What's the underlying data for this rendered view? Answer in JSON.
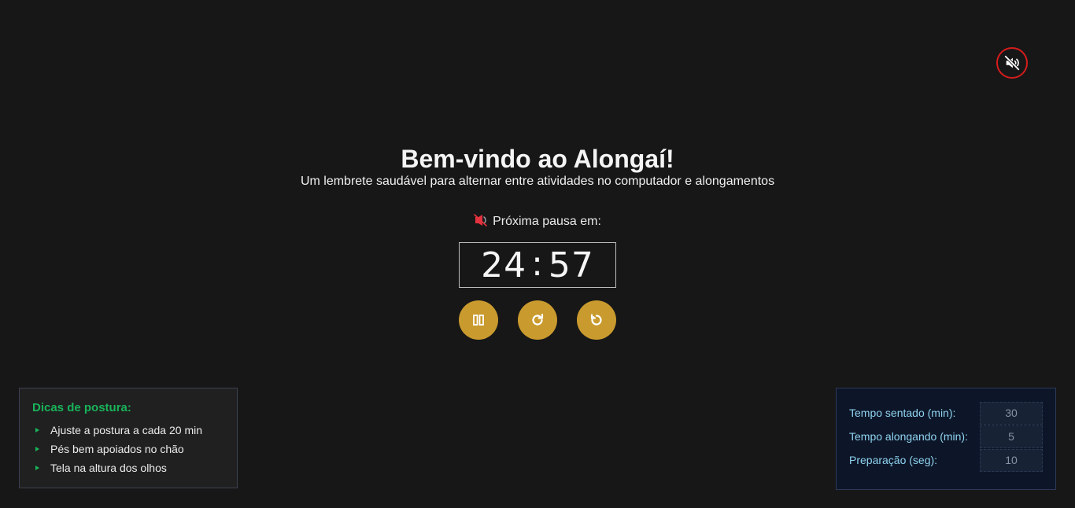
{
  "sound": {
    "icon": "speaker-muted-icon",
    "accent": "#d51c1c"
  },
  "hero": {
    "title": "Bem-vindo ao Alongaí!",
    "subtitle": "Um lembrete saudável para alternar entre atividades no computador e alongamentos"
  },
  "next_break": {
    "icon": "bell-off-icon",
    "label": "Próxima pausa em:",
    "minutes": "24",
    "separator": ":",
    "seconds": "57"
  },
  "controls": [
    {
      "icon": "pause-icon"
    },
    {
      "icon": "refresh-icon"
    },
    {
      "icon": "reset-icon"
    }
  ],
  "tips": {
    "title": "Dicas de postura:",
    "items": [
      "Ajuste a postura a cada 20 min",
      "Pés bem apoiados no chão",
      "Tela na altura dos olhos"
    ]
  },
  "settings": {
    "sitting_label": "Tempo sentado (min):",
    "sitting_value": "30",
    "stretching_label": "Tempo alongando (min):",
    "stretching_value": "5",
    "prep_label": "Preparação (seg):",
    "prep_value": "10"
  },
  "colors": {
    "background": "#171717",
    "button_gold": "#c99a2e",
    "tips_green": "#19b35a",
    "settings_label": "#8fd3f0"
  }
}
